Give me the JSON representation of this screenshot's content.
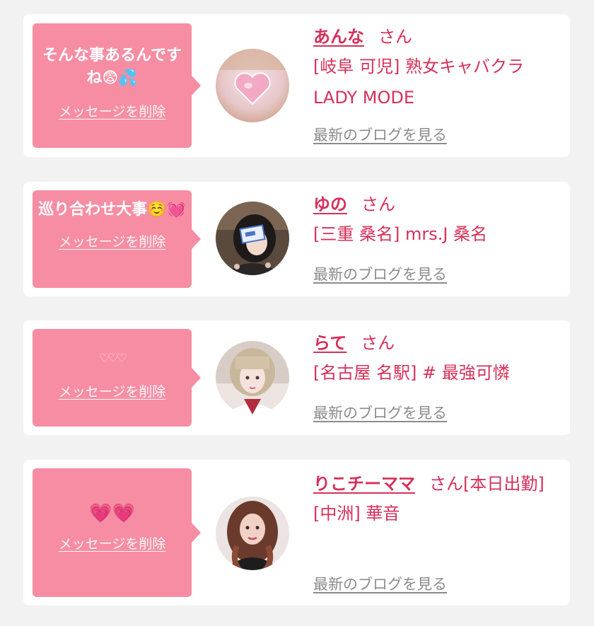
{
  "colors": {
    "page_background": "#f2f2f2",
    "card_background": "#ffffff",
    "bubble": "#f78da3",
    "name_text": "#d6305a",
    "blog_link": "#8b8b8b"
  },
  "common": {
    "delete_label": "メッセージを削除",
    "blog_label": "最新のブログを見る",
    "honorific": "さん"
  },
  "messages": [
    {
      "message_text": "そんな事あるんですね",
      "message_emoji": "😨💦",
      "name": "あんな",
      "honorific_suffix": "",
      "location": "[岐阜 可児] 熟女キャバクラ",
      "location_line2": "LADY MODE",
      "avatar_icon": "pink-heart-photo"
    },
    {
      "message_text": "巡り合わせ大事",
      "message_emoji": "☺️💓",
      "name": "ゆの",
      "honorific_suffix": "",
      "location": "[三重 桑名] mrs.J 桑名",
      "avatar_icon": "girl-with-card-photo"
    },
    {
      "message_text": "♡♡♡",
      "message_emoji": "",
      "name": "らて",
      "honorific_suffix": "",
      "location": "[名古屋 名駅]  # 最強可憐",
      "avatar_icon": "blonde-girl-photo"
    },
    {
      "message_text": "💗💗",
      "message_emoji": "",
      "name": "りこチーママ",
      "honorific_suffix": "[本日出勤]",
      "location": "[中洲] 華音",
      "avatar_icon": "brunette-woman-photo"
    }
  ]
}
